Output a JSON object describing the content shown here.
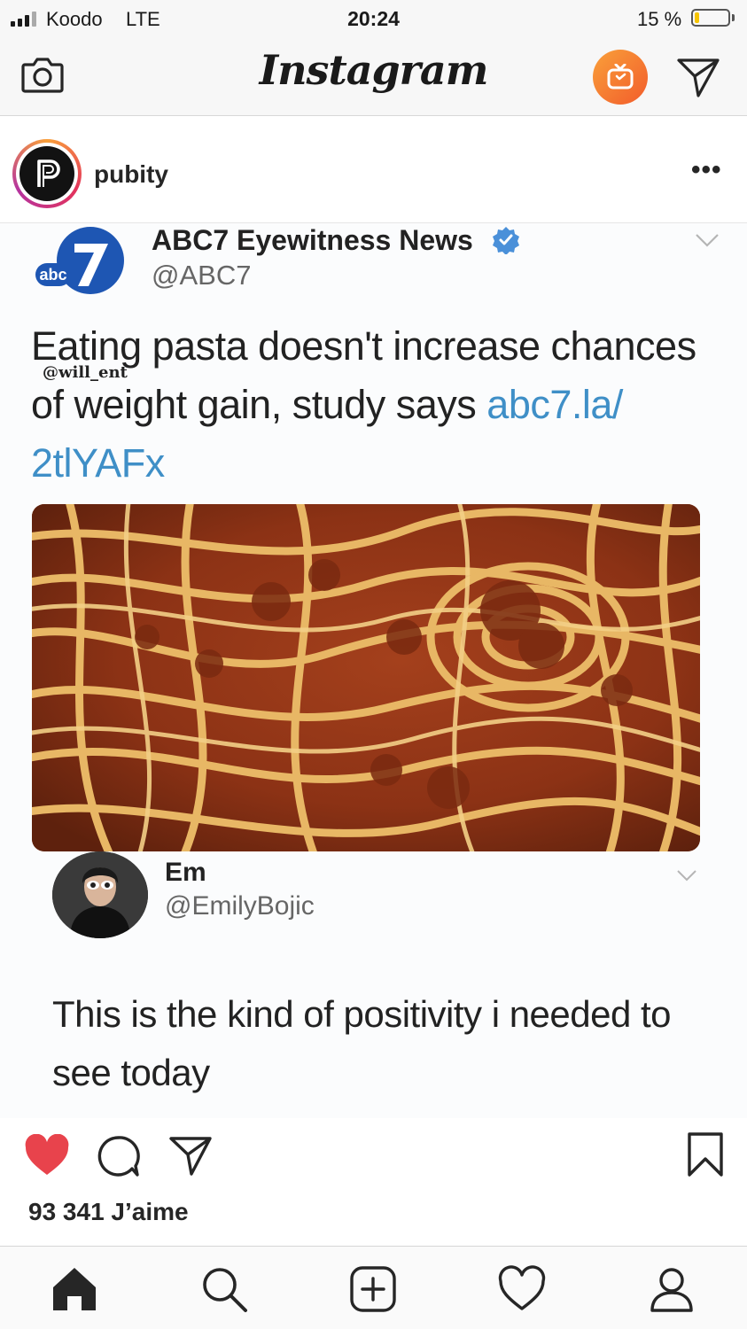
{
  "status_bar": {
    "carrier": "Koodo",
    "network": "LTE",
    "time": "20:24",
    "battery": "15 %",
    "battery_level": 0.15
  },
  "top_nav": {
    "logo": "Instagram",
    "icons": [
      "camera-icon",
      "igtv-icon",
      "direct-send-icon"
    ]
  },
  "post": {
    "username": "pubity",
    "more": "•••",
    "tweet": {
      "name": "ABC7 Eyewitness News",
      "handle": "@ABC7",
      "text_main": "Eating pasta doesn't increase chances of weight gain, study says ",
      "link": "abc7.la/ 2tlYAFx",
      "watermark": "@will_ent",
      "photo_subject": "spaghetti-bolognese-photo"
    },
    "reply": {
      "name": "Em",
      "handle": "@EmilyBojic",
      "text": "This is the kind of positivity i needed to see today"
    },
    "likes": "93 341 J’aime",
    "colors": {
      "like_active": "#e8434c",
      "link_blue": "#3f8fc7",
      "verified_blue": "#4a90d9"
    }
  },
  "tab_bar": {
    "icons": [
      "home-icon",
      "search-icon",
      "add-post-icon",
      "activity-heart-icon",
      "profile-icon"
    ]
  }
}
